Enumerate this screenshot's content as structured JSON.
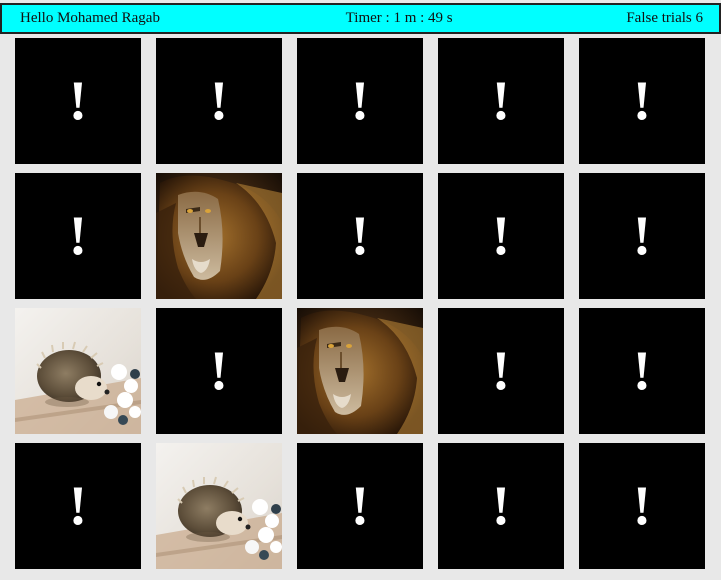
{
  "header": {
    "greeting": "Hello Mohamed Ragab",
    "timer": "Timer : 1 m : 49 s",
    "false_trials": "False trials 6"
  },
  "cards": [
    {
      "state": "hidden",
      "face": "!"
    },
    {
      "state": "hidden",
      "face": "!"
    },
    {
      "state": "hidden",
      "face": "!"
    },
    {
      "state": "hidden",
      "face": "!"
    },
    {
      "state": "hidden",
      "face": "!"
    },
    {
      "state": "hidden",
      "face": "!"
    },
    {
      "state": "revealed",
      "image": "lion"
    },
    {
      "state": "hidden",
      "face": "!"
    },
    {
      "state": "hidden",
      "face": "!"
    },
    {
      "state": "hidden",
      "face": "!"
    },
    {
      "state": "revealed",
      "image": "hedgehog"
    },
    {
      "state": "hidden",
      "face": "!"
    },
    {
      "state": "revealed",
      "image": "lion"
    },
    {
      "state": "hidden",
      "face": "!"
    },
    {
      "state": "hidden",
      "face": "!"
    },
    {
      "state": "hidden",
      "face": "!"
    },
    {
      "state": "revealed",
      "image": "hedgehog"
    },
    {
      "state": "hidden",
      "face": "!"
    },
    {
      "state": "hidden",
      "face": "!"
    },
    {
      "state": "hidden",
      "face": "!"
    }
  ]
}
